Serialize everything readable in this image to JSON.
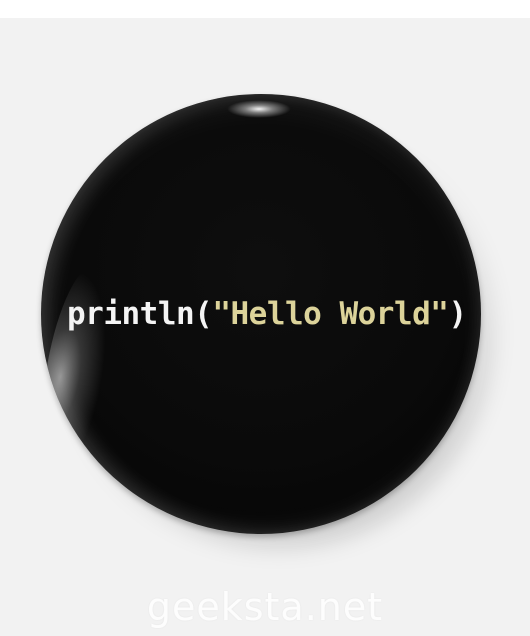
{
  "pin": {
    "code": {
      "function": "println",
      "open_paren": "(",
      "string": "\"Hello World\"",
      "close_paren": ")"
    }
  },
  "watermark": "geeksta.net"
}
